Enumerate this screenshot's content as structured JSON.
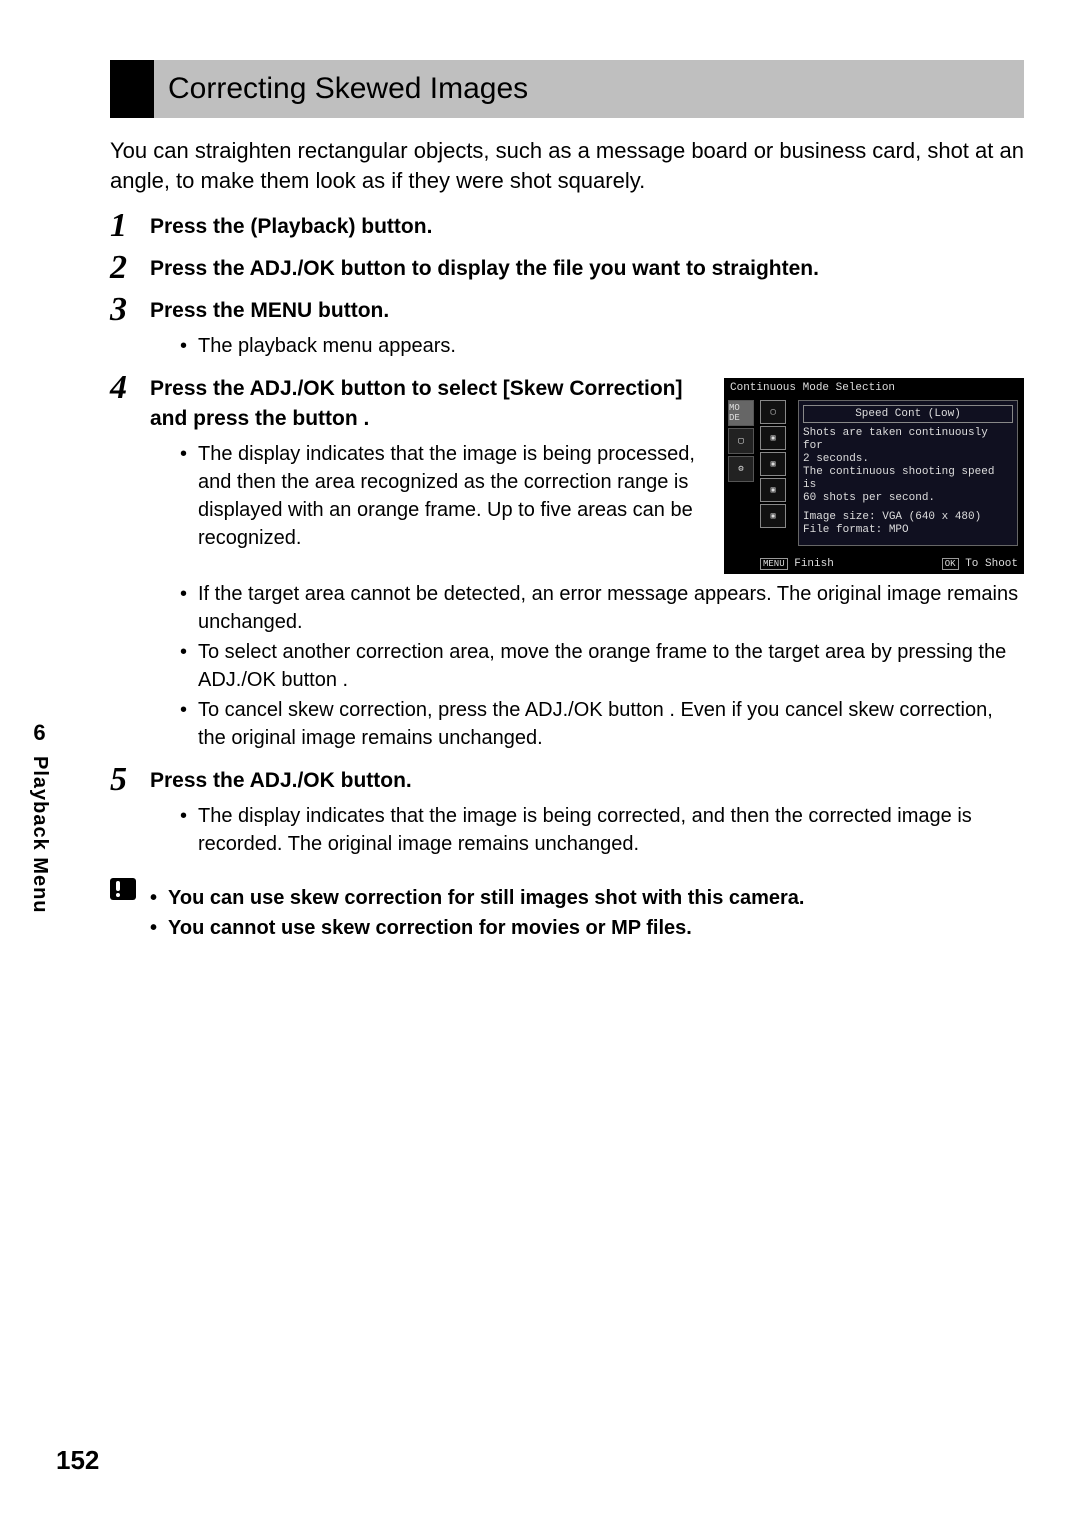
{
  "section_title": "Correcting Skewed Images",
  "intro": "You can straighten rectangular objects, such as a message board or business card, shot at an angle, to make them look as if they were shot squarely.",
  "steps": {
    "s1": {
      "head": "Press the      (Playback) button."
    },
    "s2": {
      "head": "Press the ADJ./OK button               to display the file you want to straighten."
    },
    "s3": {
      "head": "Press the MENU button.",
      "b1": "The playback menu appears."
    },
    "s4": {
      "head": "Press the ADJ./OK button      to select [Skew Correction] and press the button     .",
      "b1": "The display indicates that the image is being processed, and then the area recognized as the correction range is displayed with an orange frame. Up to five areas can be recognized.",
      "b2": "If the target area cannot be detected, an error message appears. The original image remains unchanged.",
      "b3": "To select another correction area, move the orange frame to the target area by pressing the ADJ./OK button     .",
      "b4": "To cancel skew correction, press the ADJ./OK button     . Even if you cancel skew correction, the original image remains unchanged."
    },
    "s5": {
      "head": "Press the ADJ./OK button.",
      "b1": "The display indicates that the image is being corrected, and then the corrected image is recorded. The original image remains unchanged."
    }
  },
  "caution": {
    "c1": "You can use skew correction for still images shot with this camera.",
    "c2": "You cannot use skew correction for movies or MP files."
  },
  "lcd": {
    "title": "Continuous Mode Selection",
    "speed": "Speed Cont (Low)",
    "l1": "Shots are taken continuously for",
    "l2": "2 seconds.",
    "l3": "The continuous shooting speed is",
    "l4": "60 shots per second.",
    "l5": "Image size: VGA (640 x 480)",
    "l6": "File format: MPO",
    "menu_lbl": "MENU",
    "finish": "Finish",
    "ok_lbl": "OK",
    "toshoot": "To Shoot",
    "side_icons": {
      "a": "MO DE",
      "b": "◻",
      "c": "⬚",
      "d": "⬚",
      "e": "⬚",
      "f": "⬚"
    }
  },
  "side": {
    "chapter": "6",
    "label": "Playback Menu"
  },
  "page_number": "152"
}
